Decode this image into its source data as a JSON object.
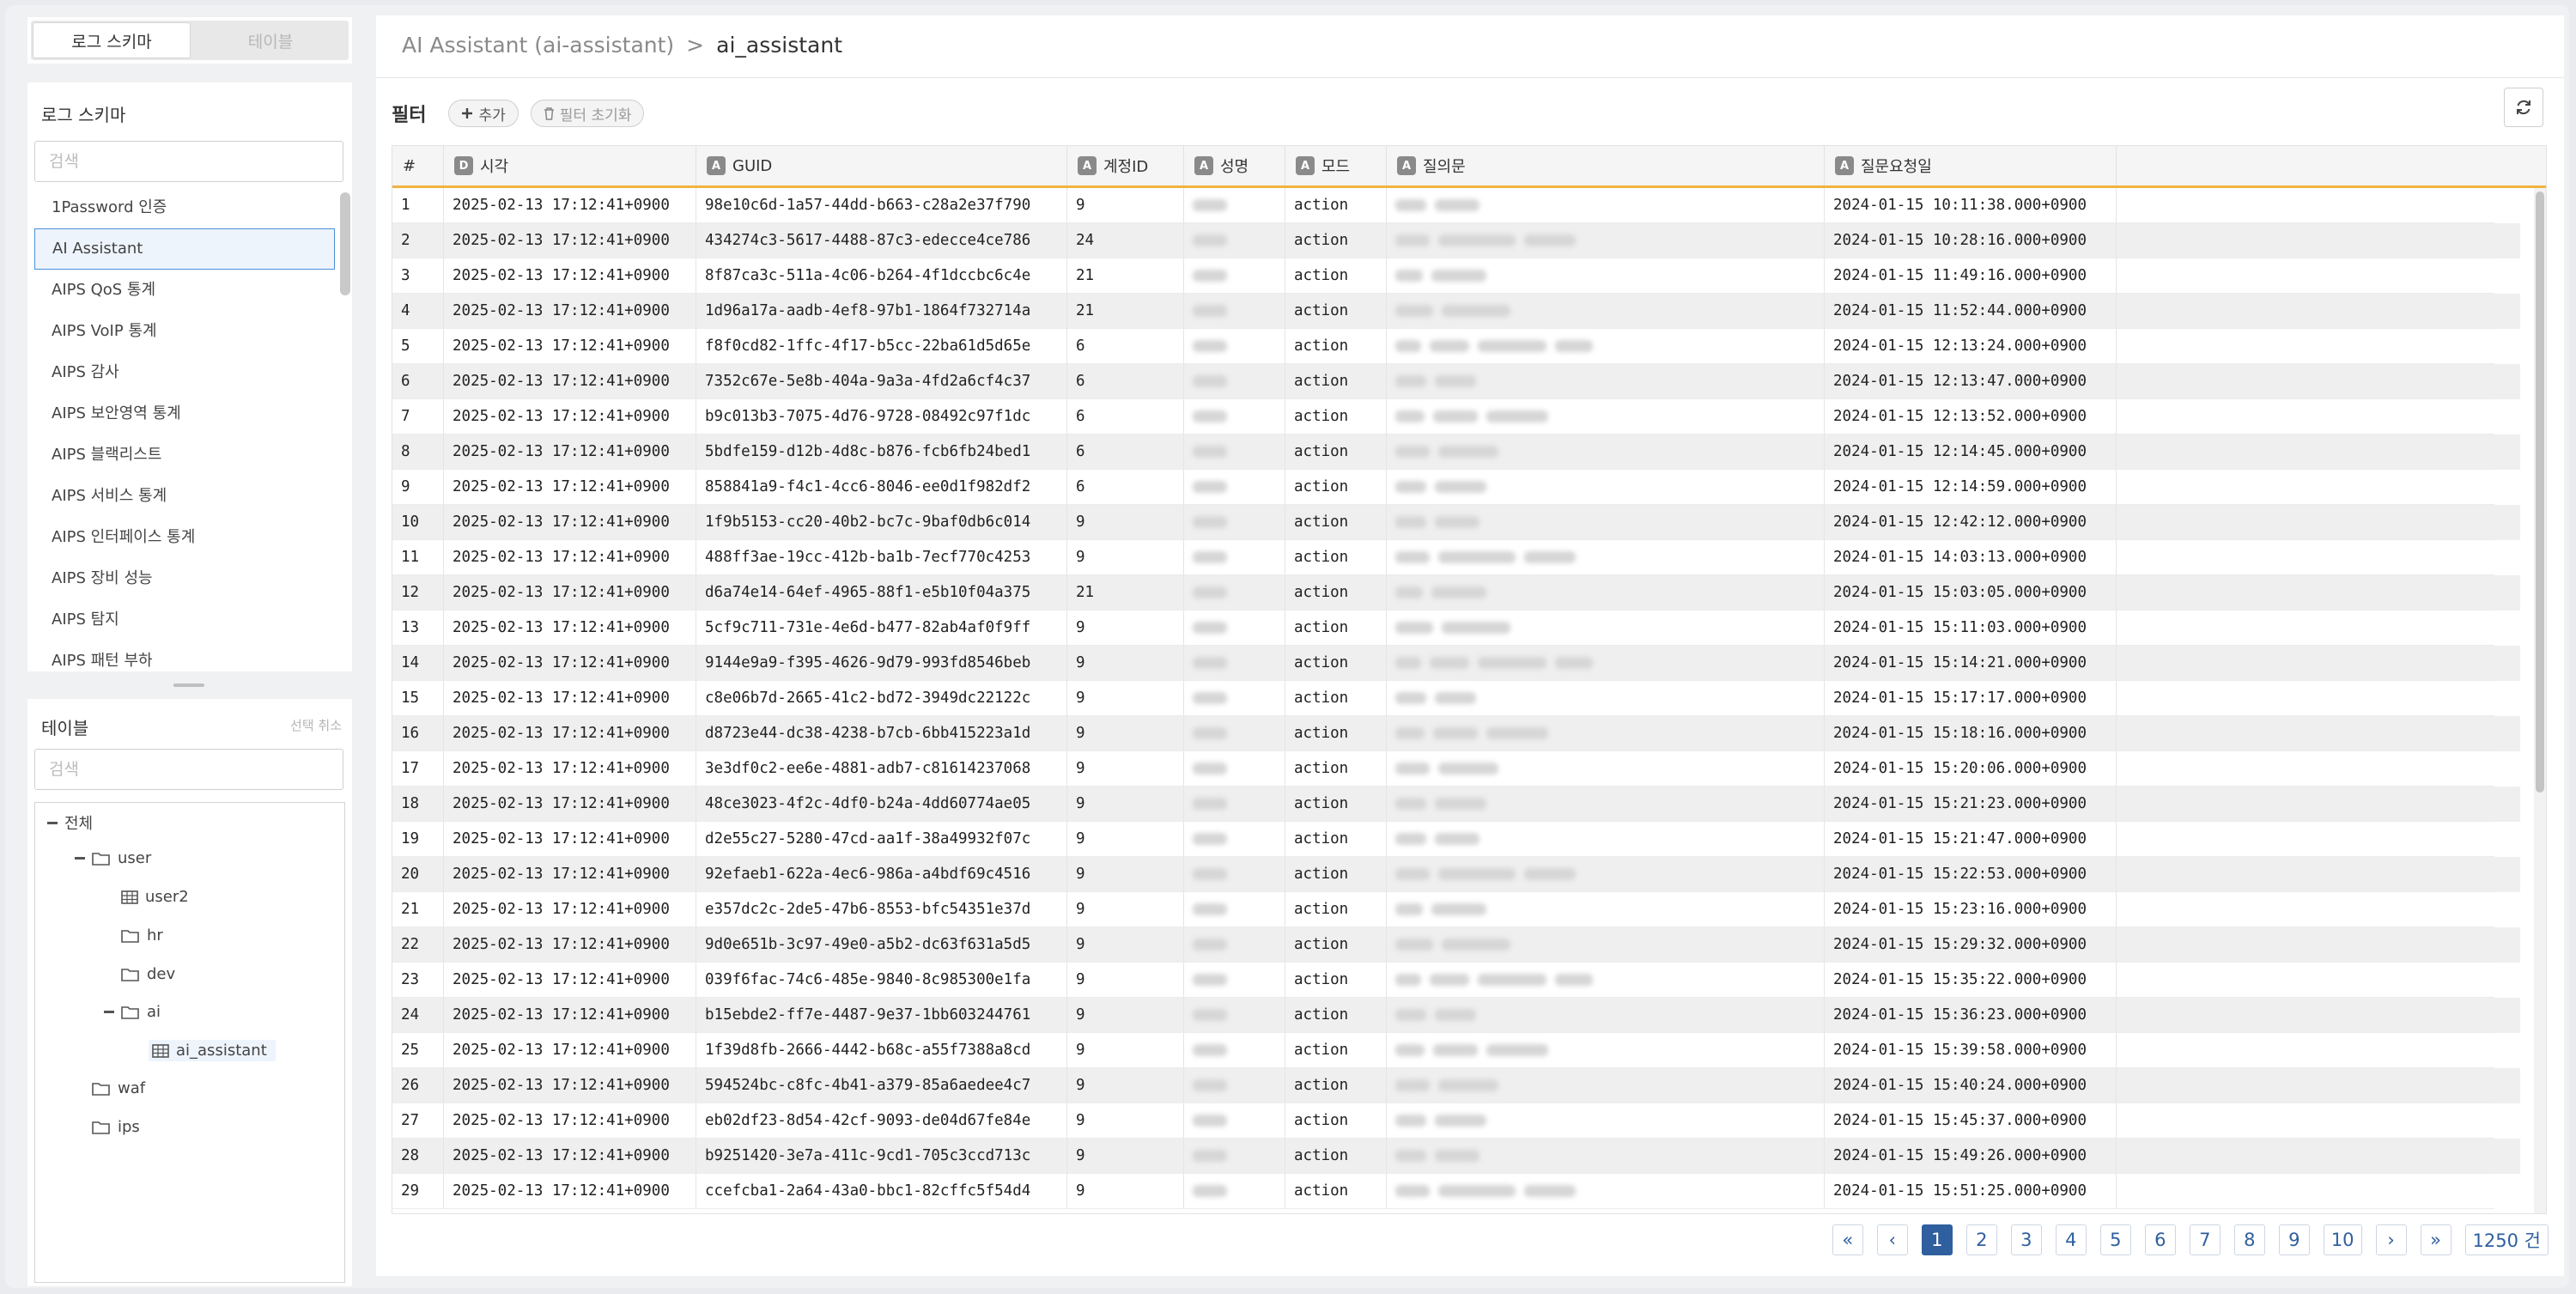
{
  "sidebar": {
    "tabs": [
      "로그 스키마",
      "테이블"
    ],
    "schema_title": "로그 스키마",
    "schema_search_placeholder": "검색",
    "schema_items": [
      "1Password 인증",
      "AI Assistant",
      "AIPS QoS 통계",
      "AIPS VoIP 통계",
      "AIPS 감사",
      "AIPS 보안영역 통계",
      "AIPS 블랙리스트",
      "AIPS 서비스 통계",
      "AIPS 인터페이스 통계",
      "AIPS 장비 성능",
      "AIPS 탐지",
      "AIPS 패턴 부하"
    ],
    "selected_schema": "AI Assistant",
    "table_title": "테이블",
    "deselect_label": "선택 취소",
    "table_search_placeholder": "검색",
    "tree": {
      "root": "전체",
      "user": "user",
      "user2": "user2",
      "hr": "hr",
      "dev": "dev",
      "ai": "ai",
      "ai_assistant": "ai_assistant",
      "waf": "waf",
      "ips": "ips"
    }
  },
  "main": {
    "breadcrumb_parent": "AI Assistant (ai-assistant)",
    "breadcrumb_sep": ">",
    "breadcrumb_current": "ai_assistant",
    "filter_label": "필터",
    "add_label": "추가",
    "reset_label": "필터 초기화",
    "columns": [
      {
        "badge": "",
        "label": "#"
      },
      {
        "badge": "D",
        "label": "시각"
      },
      {
        "badge": "A",
        "label": "GUID"
      },
      {
        "badge": "A",
        "label": "계정ID"
      },
      {
        "badge": "A",
        "label": "성명"
      },
      {
        "badge": "A",
        "label": "모드"
      },
      {
        "badge": "A",
        "label": "질의문"
      },
      {
        "badge": "A",
        "label": "질문요청일"
      }
    ],
    "rows": [
      [
        "1",
        "2025-02-13 17:12:41+0900",
        "98e10c6d-1a57-44dd-b663-c28a2e37f790",
        "9",
        "action",
        "2024-01-15 10:11:38.000+0900"
      ],
      [
        "2",
        "2025-02-13 17:12:41+0900",
        "434274c3-5617-4488-87c3-edecce4ce786",
        "24",
        "action",
        "2024-01-15 10:28:16.000+0900"
      ],
      [
        "3",
        "2025-02-13 17:12:41+0900",
        "8f87ca3c-511a-4c06-b264-4f1dccbc6c4e",
        "21",
        "action",
        "2024-01-15 11:49:16.000+0900"
      ],
      [
        "4",
        "2025-02-13 17:12:41+0900",
        "1d96a17a-aadb-4ef8-97b1-1864f732714a",
        "21",
        "action",
        "2024-01-15 11:52:44.000+0900"
      ],
      [
        "5",
        "2025-02-13 17:12:41+0900",
        "f8f0cd82-1ffc-4f17-b5cc-22ba61d5d65e",
        "6",
        "action",
        "2024-01-15 12:13:24.000+0900"
      ],
      [
        "6",
        "2025-02-13 17:12:41+0900",
        "7352c67e-5e8b-404a-9a3a-4fd2a6cf4c37",
        "6",
        "action",
        "2024-01-15 12:13:47.000+0900"
      ],
      [
        "7",
        "2025-02-13 17:12:41+0900",
        "b9c013b3-7075-4d76-9728-08492c97f1dc",
        "6",
        "action",
        "2024-01-15 12:13:52.000+0900"
      ],
      [
        "8",
        "2025-02-13 17:12:41+0900",
        "5bdfe159-d12b-4d8c-b876-fcb6fb24bed1",
        "6",
        "action",
        "2024-01-15 12:14:45.000+0900"
      ],
      [
        "9",
        "2025-02-13 17:12:41+0900",
        "858841a9-f4c1-4cc6-8046-ee0d1f982df2",
        "6",
        "action",
        "2024-01-15 12:14:59.000+0900"
      ],
      [
        "10",
        "2025-02-13 17:12:41+0900",
        "1f9b5153-cc20-40b2-bc7c-9baf0db6c014",
        "9",
        "action",
        "2024-01-15 12:42:12.000+0900"
      ],
      [
        "11",
        "2025-02-13 17:12:41+0900",
        "488ff3ae-19cc-412b-ba1b-7ecf770c4253",
        "9",
        "action",
        "2024-01-15 14:03:13.000+0900"
      ],
      [
        "12",
        "2025-02-13 17:12:41+0900",
        "d6a74e14-64ef-4965-88f1-e5b10f04a375",
        "21",
        "action",
        "2024-01-15 15:03:05.000+0900"
      ],
      [
        "13",
        "2025-02-13 17:12:41+0900",
        "5cf9c711-731e-4e6d-b477-82ab4af0f9ff",
        "9",
        "action",
        "2024-01-15 15:11:03.000+0900"
      ],
      [
        "14",
        "2025-02-13 17:12:41+0900",
        "9144e9a9-f395-4626-9d79-993fd8546beb",
        "9",
        "action",
        "2024-01-15 15:14:21.000+0900"
      ],
      [
        "15",
        "2025-02-13 17:12:41+0900",
        "c8e06b7d-2665-41c2-bd72-3949dc22122c",
        "9",
        "action",
        "2024-01-15 15:17:17.000+0900"
      ],
      [
        "16",
        "2025-02-13 17:12:41+0900",
        "d8723e44-dc38-4238-b7cb-6bb415223a1d",
        "9",
        "action",
        "2024-01-15 15:18:16.000+0900"
      ],
      [
        "17",
        "2025-02-13 17:12:41+0900",
        "3e3df0c2-ee6e-4881-adb7-c81614237068",
        "9",
        "action",
        "2024-01-15 15:20:06.000+0900"
      ],
      [
        "18",
        "2025-02-13 17:12:41+0900",
        "48ce3023-4f2c-4df0-b24a-4dd60774ae05",
        "9",
        "action",
        "2024-01-15 15:21:23.000+0900"
      ],
      [
        "19",
        "2025-02-13 17:12:41+0900",
        "d2e55c27-5280-47cd-aa1f-38a49932f07c",
        "9",
        "action",
        "2024-01-15 15:21:47.000+0900"
      ],
      [
        "20",
        "2025-02-13 17:12:41+0900",
        "92efaeb1-622a-4ec6-986a-a4bdf69c4516",
        "9",
        "action",
        "2024-01-15 15:22:53.000+0900"
      ],
      [
        "21",
        "2025-02-13 17:12:41+0900",
        "e357dc2c-2de5-47b6-8553-bfc54351e37d",
        "9",
        "action",
        "2024-01-15 15:23:16.000+0900"
      ],
      [
        "22",
        "2025-02-13 17:12:41+0900",
        "9d0e651b-3c97-49e0-a5b2-dc63f631a5d5",
        "9",
        "action",
        "2024-01-15 15:29:32.000+0900"
      ],
      [
        "23",
        "2025-02-13 17:12:41+0900",
        "039f6fac-74c6-485e-9840-8c985300e1fa",
        "9",
        "action",
        "2024-01-15 15:35:22.000+0900"
      ],
      [
        "24",
        "2025-02-13 17:12:41+0900",
        "b15ebde2-ff7e-4487-9e37-1bb603244761",
        "9",
        "action",
        "2024-01-15 15:36:23.000+0900"
      ],
      [
        "25",
        "2025-02-13 17:12:41+0900",
        "1f39d8fb-2666-4442-b68c-a55f7388a8cd",
        "9",
        "action",
        "2024-01-15 15:39:58.000+0900"
      ],
      [
        "26",
        "2025-02-13 17:12:41+0900",
        "594524bc-c8fc-4b41-a379-85a6aedee4c7",
        "9",
        "action",
        "2024-01-15 15:40:24.000+0900"
      ],
      [
        "27",
        "2025-02-13 17:12:41+0900",
        "eb02df23-8d54-42cf-9093-de04d67fe84e",
        "9",
        "action",
        "2024-01-15 15:45:37.000+0900"
      ],
      [
        "28",
        "2025-02-13 17:12:41+0900",
        "b9251420-3e7a-411c-9cd1-705c3ccd713c",
        "9",
        "action",
        "2024-01-15 15:49:26.000+0900"
      ],
      [
        "29",
        "2025-02-13 17:12:41+0900",
        "ccefcba1-2a64-43a0-bbc1-82cffc5f54d4",
        "9",
        "action",
        "2024-01-15 15:51:25.000+0900"
      ]
    ],
    "pagination": {
      "first": "«",
      "prev": "‹",
      "next": "›",
      "last": "»",
      "pages": [
        "1",
        "2",
        "3",
        "4",
        "5",
        "6",
        "7",
        "8",
        "9",
        "10"
      ],
      "active_page": "1",
      "total": "1250 건"
    }
  },
  "icons": {
    "add": "plus-icon",
    "reset": "trash-icon",
    "refresh": "refresh-icon",
    "folder": "folder-icon",
    "table": "table-icon"
  },
  "colors": {
    "accent": "#2f5f9e",
    "header_underline": "#f0b341",
    "selected_border": "#4a90d9"
  }
}
